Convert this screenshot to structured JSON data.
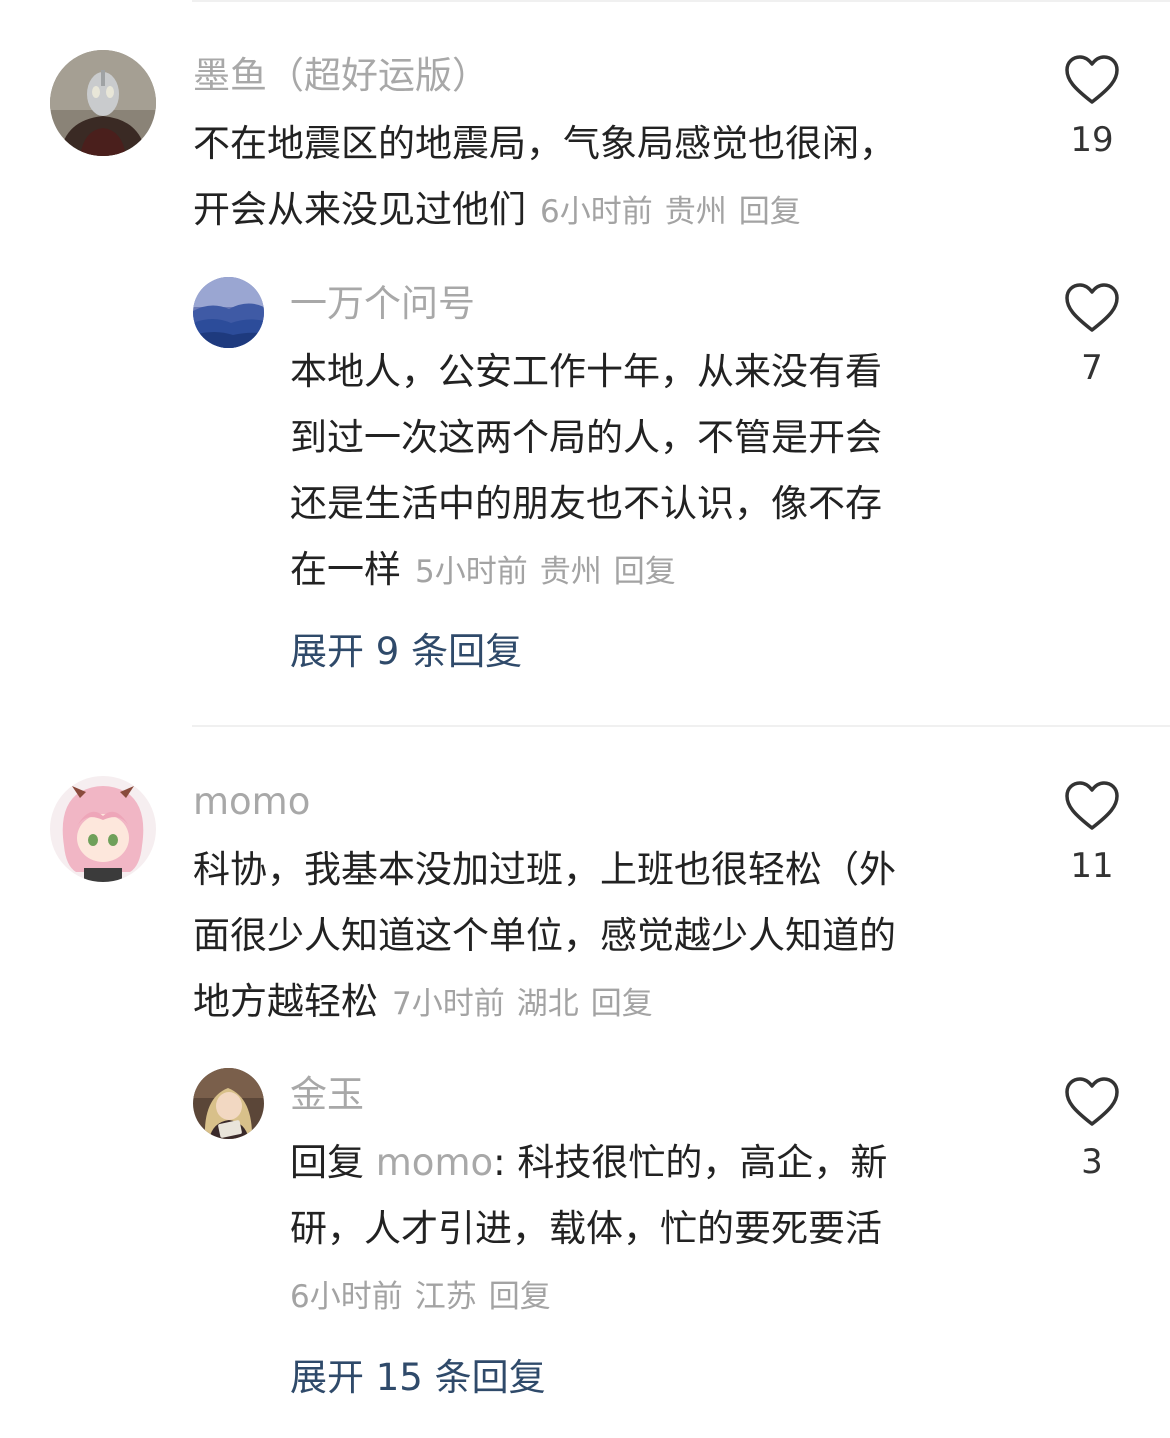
{
  "comments": [
    {
      "username": "墨鱼（超好运版）",
      "lines": [
        "不在地震区的地震局，气象局感觉也很闲，",
        "开会从来没见过他们"
      ],
      "time": "6小时前",
      "location": "贵州",
      "reply_label": "回复",
      "likes": "19",
      "avatar_icon": "ultraman-avatar",
      "replies": [
        {
          "username": "一万个问号",
          "lines": [
            "本地人，公安工作十年，从来没有看",
            "到过一次这两个局的人，不管是开会",
            "还是生活中的朋友也不认识，像不存",
            "在一样"
          ],
          "time": "5小时前",
          "location": "贵州",
          "reply_label": "回复",
          "likes": "7",
          "avatar_icon": "landscape-avatar"
        }
      ],
      "expand_label": "展开 9 条回复"
    },
    {
      "username": "momo",
      "lines": [
        "科协，我基本没加过班，上班也很轻松（外",
        "面很少人知道这个单位，感觉越少人知道的",
        "地方越轻松"
      ],
      "time": "7小时前",
      "location": "湖北",
      "reply_label": "回复",
      "likes": "11",
      "avatar_icon": "anime-girl-avatar",
      "replies": [
        {
          "username": "金玉",
          "reply_prefix": "回复",
          "mention": "momo",
          "lines_first_rest": ": 科技很忙的，高企，新",
          "lines": [
            "研，人才引进，载体，忙的要死要活"
          ],
          "time": "6小时前",
          "location": "江苏",
          "reply_label": "回复",
          "likes": "3",
          "avatar_icon": "reading-girl-avatar"
        }
      ],
      "expand_label": "展开 15 条回复"
    }
  ],
  "colors": {
    "text": "#222222",
    "muted": "#a3a3a3",
    "link": "#2f4a6a",
    "divider": "#f0f0f0"
  }
}
